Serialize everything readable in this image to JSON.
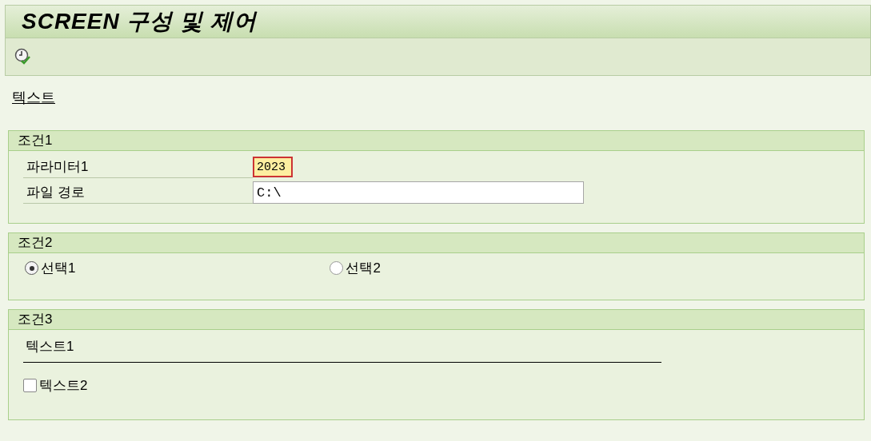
{
  "window": {
    "title": "SCREEN 구성 및 제어"
  },
  "intro_text": "텍스트",
  "groups": [
    {
      "kind": "fields",
      "title": "조건1",
      "fields": [
        {
          "label": "파라미터1",
          "value": "2023",
          "focused": true
        },
        {
          "label": "파일 경로",
          "value": "C:\\",
          "focused": false
        }
      ]
    },
    {
      "kind": "radios",
      "title": "조건2",
      "options": [
        {
          "label": "선택1",
          "selected": true
        },
        {
          "label": "선택2",
          "selected": false
        }
      ]
    },
    {
      "kind": "text_checkbox",
      "title": "조건3",
      "text": "텍스트1",
      "checkbox": {
        "label": "텍스트2",
        "checked": false
      }
    }
  ]
}
